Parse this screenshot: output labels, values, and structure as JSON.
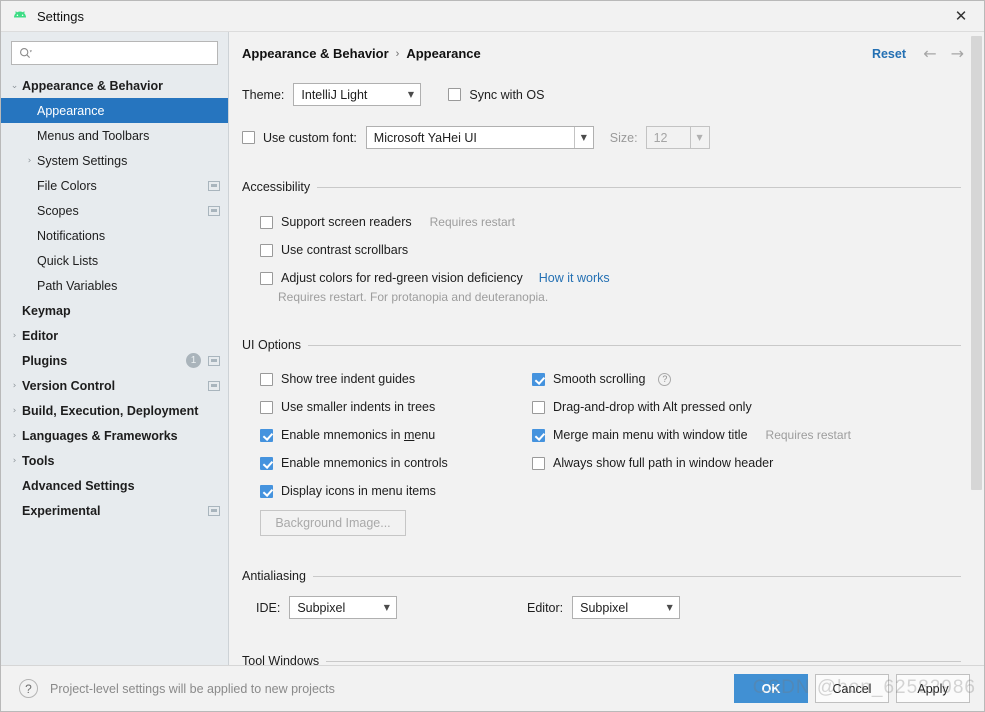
{
  "window": {
    "title": "Settings",
    "app_icon": "android-studio-icon",
    "close_icon": "✕"
  },
  "sidebar": {
    "search": {
      "placeholder": "",
      "value": "",
      "icon": "search-icon"
    },
    "items": [
      {
        "label": "Appearance & Behavior",
        "indent": 0,
        "arrow": "⌄",
        "bold": true,
        "selected": false,
        "project_icon": false,
        "badge": ""
      },
      {
        "label": "Appearance",
        "indent": 1,
        "arrow": "",
        "bold": false,
        "selected": true,
        "project_icon": false,
        "badge": ""
      },
      {
        "label": "Menus and Toolbars",
        "indent": 1,
        "arrow": "",
        "bold": false,
        "selected": false,
        "project_icon": false,
        "badge": ""
      },
      {
        "label": "System Settings",
        "indent": 1,
        "arrow": "›",
        "bold": false,
        "selected": false,
        "project_icon": false,
        "badge": ""
      },
      {
        "label": "File Colors",
        "indent": 1,
        "arrow": "",
        "bold": false,
        "selected": false,
        "project_icon": true,
        "badge": ""
      },
      {
        "label": "Scopes",
        "indent": 1,
        "arrow": "",
        "bold": false,
        "selected": false,
        "project_icon": true,
        "badge": ""
      },
      {
        "label": "Notifications",
        "indent": 1,
        "arrow": "",
        "bold": false,
        "selected": false,
        "project_icon": false,
        "badge": ""
      },
      {
        "label": "Quick Lists",
        "indent": 1,
        "arrow": "",
        "bold": false,
        "selected": false,
        "project_icon": false,
        "badge": ""
      },
      {
        "label": "Path Variables",
        "indent": 1,
        "arrow": "",
        "bold": false,
        "selected": false,
        "project_icon": false,
        "badge": ""
      },
      {
        "label": "Keymap",
        "indent": 0,
        "arrow": "",
        "bold": true,
        "selected": false,
        "project_icon": false,
        "badge": ""
      },
      {
        "label": "Editor",
        "indent": 0,
        "arrow": "›",
        "bold": true,
        "selected": false,
        "project_icon": false,
        "badge": ""
      },
      {
        "label": "Plugins",
        "indent": 0,
        "arrow": "",
        "bold": true,
        "selected": false,
        "project_icon": true,
        "badge": "1"
      },
      {
        "label": "Version Control",
        "indent": 0,
        "arrow": "›",
        "bold": true,
        "selected": false,
        "project_icon": true,
        "badge": ""
      },
      {
        "label": "Build, Execution, Deployment",
        "indent": 0,
        "arrow": "›",
        "bold": true,
        "selected": false,
        "project_icon": false,
        "badge": ""
      },
      {
        "label": "Languages & Frameworks",
        "indent": 0,
        "arrow": "›",
        "bold": true,
        "selected": false,
        "project_icon": false,
        "badge": ""
      },
      {
        "label": "Tools",
        "indent": 0,
        "arrow": "›",
        "bold": true,
        "selected": false,
        "project_icon": false,
        "badge": ""
      },
      {
        "label": "Advanced Settings",
        "indent": 0,
        "arrow": "",
        "bold": true,
        "selected": false,
        "project_icon": false,
        "badge": ""
      },
      {
        "label": "Experimental",
        "indent": 0,
        "arrow": "",
        "bold": true,
        "selected": false,
        "project_icon": true,
        "badge": ""
      }
    ]
  },
  "content": {
    "breadcrumb": {
      "root": "Appearance & Behavior",
      "separator": "›",
      "leaf": "Appearance"
    },
    "reset_label": "Reset",
    "nav_back_icon": "←",
    "nav_forward_icon": "→",
    "theme": {
      "label": "Theme:",
      "value": "IntelliJ Light",
      "sync_label": "Sync with OS",
      "sync_checked": false
    },
    "custom_font": {
      "checkbox_label": "Use custom font:",
      "checked": false,
      "value": "Microsoft YaHei UI",
      "size_label": "Size:",
      "size_value": "12"
    },
    "accessibility": {
      "title": "Accessibility",
      "options": [
        {
          "label": "Support screen readers",
          "checked": false,
          "hint": "Requires restart",
          "link": ""
        },
        {
          "label": "Use contrast scrollbars",
          "checked": false,
          "hint": "",
          "link": ""
        },
        {
          "label": "Adjust colors for red-green vision deficiency",
          "checked": false,
          "hint": "",
          "link": "How it works"
        }
      ],
      "note": "Requires restart. For protanopia and deuteranopia."
    },
    "ui_options": {
      "title": "UI Options",
      "left_column": [
        {
          "label": "Show tree indent guides",
          "checked": false,
          "mnemonic": ""
        },
        {
          "label": "Use smaller indents in trees",
          "checked": false,
          "mnemonic": ""
        },
        {
          "label": "Enable mnemonics in menu",
          "checked": true,
          "mnemonic": "m"
        },
        {
          "label": "Enable mnemonics in controls",
          "checked": true,
          "mnemonic": ""
        },
        {
          "label": "Display icons in menu items",
          "checked": true,
          "mnemonic": ""
        }
      ],
      "right_column": [
        {
          "label": "Smooth scrolling",
          "checked": true,
          "hint": "",
          "help": true
        },
        {
          "label": "Drag-and-drop with Alt pressed only",
          "checked": false,
          "hint": "",
          "help": false
        },
        {
          "label": "Merge main menu with window title",
          "checked": true,
          "hint": "Requires restart",
          "help": false
        },
        {
          "label": "Always show full path in window header",
          "checked": false,
          "hint": "",
          "help": false
        }
      ],
      "background_image_button": "Background Image..."
    },
    "antialiasing": {
      "title": "Antialiasing",
      "ide_label": "IDE:",
      "ide_value": "Subpixel",
      "editor_label": "Editor:",
      "editor_value": "Subpixel"
    },
    "tool_windows": {
      "title": "Tool Windows"
    }
  },
  "footer": {
    "help_icon": "?",
    "note": "Project-level settings will be applied to new projects",
    "buttons": [
      {
        "label": "OK",
        "primary": true
      },
      {
        "label": "Cancel",
        "primary": false
      },
      {
        "label": "Apply",
        "primary": false
      }
    ],
    "watermark": "CSDN @hon_62582986"
  },
  "colors": {
    "selection_blue": "#2675bf",
    "checkbox_blue": "#4593de",
    "link_blue": "#2470b3",
    "primary_button": "#4190d3",
    "sidebar_bg": "#e7ebee",
    "content_bg": "#f2f2f2"
  }
}
